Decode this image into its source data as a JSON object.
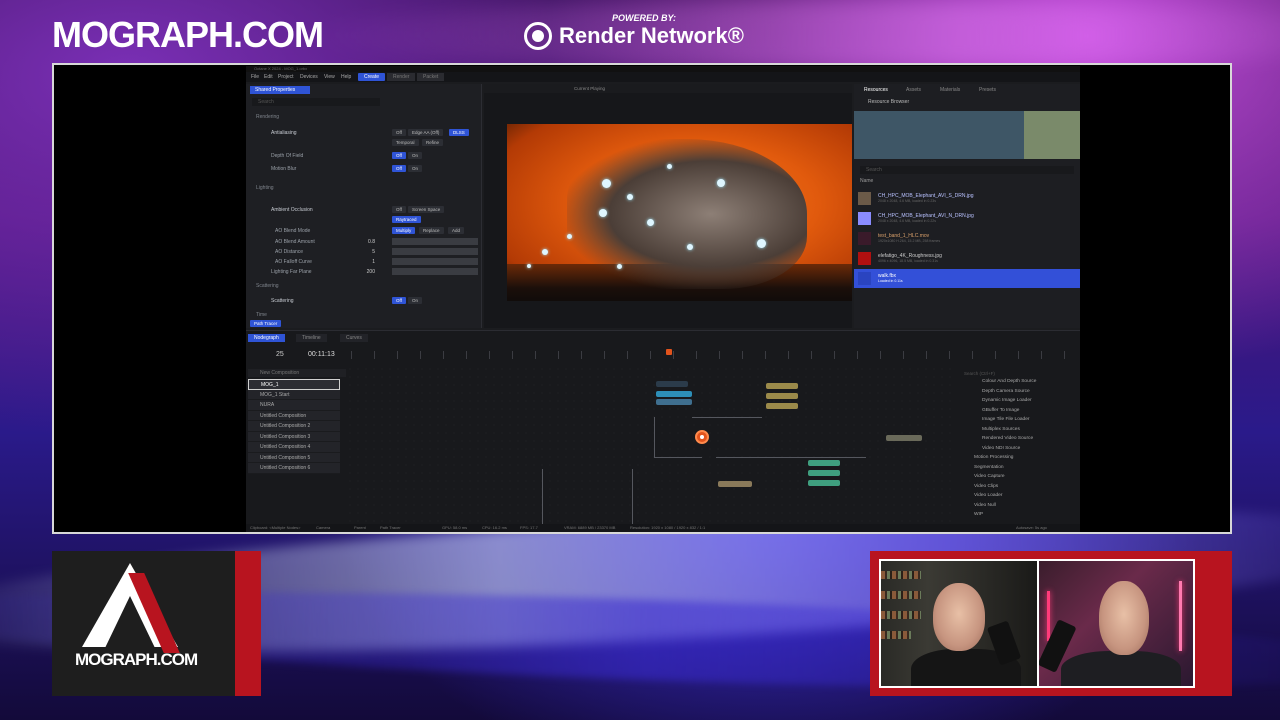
{
  "branding": {
    "site": "MOGRAPH.COM",
    "powered_by": "POWERED BY:",
    "sponsor": "Render Network®"
  },
  "app": {
    "title": "Octane X 2024 - MOG_1.orbx",
    "menu": [
      "File",
      "Edit",
      "Project",
      "Devices",
      "View",
      "Help"
    ],
    "modes": [
      "Create",
      "Render",
      "Packet"
    ],
    "properties": {
      "header": "Shared Properties",
      "search_placeholder": "Search",
      "sections": {
        "rendering": "Rendering",
        "lighting": "Lighting",
        "scattering": "Scattering",
        "time": "Time"
      },
      "antialiasing": {
        "label": "Antialiasing",
        "options": [
          "Off",
          "Edge AA (Off)",
          "DLSS",
          "Temporal",
          "Refine"
        ],
        "selected": "DLSS"
      },
      "dof": {
        "label": "Depth Of Field",
        "options": [
          "Off",
          "On"
        ],
        "selected": "Off"
      },
      "motion_blur": {
        "label": "Motion Blur",
        "options": [
          "Off",
          "On"
        ],
        "selected": "Off"
      },
      "ao": {
        "label": "Ambient Occlusion",
        "options": [
          "Off",
          "Screen Space",
          "Raytraced"
        ],
        "selected": "Raytraced"
      },
      "ao_blend": {
        "label": "AO Blend Mode",
        "options": [
          "Multiply",
          "Replace",
          "Add"
        ],
        "selected": "Multiply"
      },
      "ao_amount": {
        "label": "AO Blend Amount",
        "value": "0.8"
      },
      "ao_distance": {
        "label": "AO Distance",
        "value": "5"
      },
      "ao_falloff": {
        "label": "AO Falloff Curve",
        "value": "1"
      },
      "far_plane": {
        "label": "Lighting Far Plane",
        "value": "200"
      },
      "scatter": {
        "label": "Scattering",
        "options": [
          "Off",
          "On"
        ],
        "selected": "Off"
      },
      "footer_tab": "Path Tracer"
    },
    "viewport": {
      "mode": "Current Playing"
    },
    "resources": {
      "tabs": [
        "Resources",
        "Assets",
        "Materials",
        "Presets"
      ],
      "browser_title": "Resource Browser",
      "search_placeholder": "Search",
      "sort_label": "Name",
      "items": [
        {
          "name": "CH_HPC_MOB_Elephant_AVI_S_DRN.jpg",
          "meta": "2048 x 2048, 4.6 MB, loaded in 0.23s",
          "color": "#6b5a48"
        },
        {
          "name": "CH_HPC_MOB_Elephant_AVI_N_DRN.jpg",
          "meta": "2048 x 2048, 4.6 MB, loaded in 0.22s",
          "color": "#8a8cff"
        },
        {
          "name": "test_band_1_HLC.mov",
          "meta": "1920x1080 H.264, 15.2 MB, 258 frames",
          "color": "#3a1a2a"
        },
        {
          "name": "elefatigo_4K_Roughness.jpg",
          "meta": "4096 x 4096, 18.5 MB, loaded in 0.31s",
          "color": "#b01010"
        },
        {
          "name": "walk.fbx",
          "meta": "Loaded in 0.11s",
          "color": "#3350d8",
          "selected": true
        }
      ]
    },
    "bottom": {
      "tabs": [
        "Nodegraph",
        "Timeline",
        "Curves"
      ],
      "frame": "25",
      "timecode": "00:11:13",
      "new_comp": "New Composition",
      "compositions": [
        "MOG_1",
        "MOG_1 Start",
        "NURA",
        "Untitled Composition",
        "Untitled Composition 2",
        "Untitled Composition 3",
        "Untitled Composition 4",
        "Untitled Composition 5",
        "Untitled Composition 6"
      ],
      "node_search": "Search (Ctrl+F)",
      "node_list": [
        "Colour And Depth Source",
        "Depth Camera Source",
        "Dynamic Image Loader",
        "GBuffer To Image",
        "Image Tile File Loader",
        "Multiplex Sources",
        "Rendered Video Source",
        "Video NDI Source",
        "Motion Processing",
        "Segmentation",
        "Video Capture",
        "Video Clips",
        "Video Loader",
        "Video Null",
        "WIP"
      ]
    },
    "status": {
      "clipboard": "Clipboard: <Multiple Nodes>",
      "camera": "Camera",
      "parent": "Parent",
      "renderer": "Path Tracer",
      "gpu": "GPU: 58.0 ms",
      "cpu": "CPU: 16.2 ms",
      "fps": "FPS: 17.7",
      "vram": "VRAM: 6889 MB / 23370 MB",
      "resolution": "Resolution: 1920 x 1080 / 1920 x 832 / 1:1",
      "autosave": "Autosave: 5s ago"
    }
  },
  "colors": {
    "accent": "#2f54d6",
    "brand_red": "#b8141f",
    "render_orange": "#e15a0d"
  }
}
